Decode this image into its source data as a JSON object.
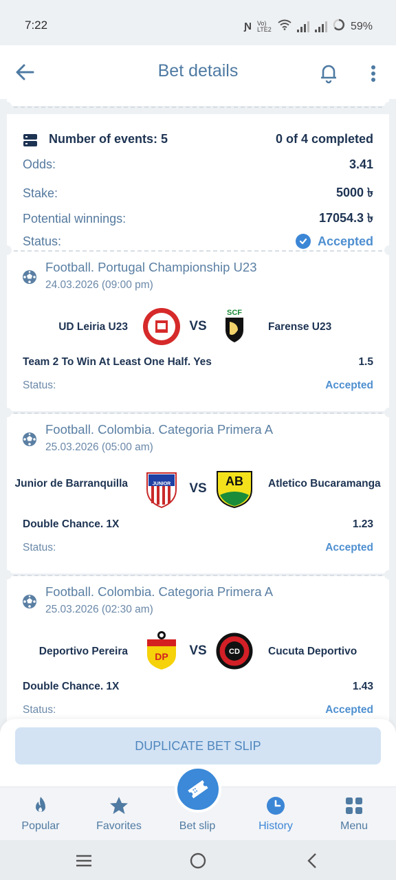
{
  "status_bar": {
    "time": "7:22",
    "battery": "59%",
    "network": "Vo) LTE2"
  },
  "header": {
    "title": "Bet details"
  },
  "summary": {
    "events_label": "Number of events: 5",
    "completed": "0 of 4 completed",
    "odds_label": "Odds:",
    "odds_value": "3.41",
    "stake_label": "Stake:",
    "stake_value": "5000 ৳",
    "winnings_label": "Potential winnings:",
    "winnings_value": "17054.3 ৳",
    "status_label": "Status:",
    "status_value": "Accepted"
  },
  "events": [
    {
      "league": "Football. Portugal Championship U23",
      "date": "24.03.2026 (09:00 pm)",
      "team1": "UD Leiria U23",
      "team2": "Farense U23",
      "vs": "VS",
      "market": "Team 2 To Win At Least One Half. Yes",
      "odds": "1.5",
      "status_label": "Status:",
      "status": "Accepted",
      "logo2_text": "SCF"
    },
    {
      "league": "Football. Colombia. Categoria Primera A",
      "date": "25.03.2026 (05:00 am)",
      "team1": "Junior de Barranquilla",
      "team2": "Atletico Bucaramanga",
      "vs": "VS",
      "market": "Double Chance. 1X",
      "odds": "1.23",
      "status_label": "Status:",
      "status": "Accepted",
      "logo1_text": "JUNIOR",
      "logo2_text": "AB"
    },
    {
      "league": "Football. Colombia. Categoria Primera A",
      "date": "25.03.2026 (02:30 am)",
      "team1": "Deportivo Pereira",
      "team2": "Cucuta Deportivo",
      "vs": "VS",
      "market": "Double Chance. 1X",
      "odds": "1.43",
      "status_label": "Status:",
      "status": "Accepted",
      "logo1_text": "DP",
      "logo2_text": "CD"
    }
  ],
  "actions": {
    "duplicate_label": "DUPLICATE BET SLIP"
  },
  "bottom_nav": [
    {
      "label": "Popular",
      "icon": "flame-icon"
    },
    {
      "label": "Favorites",
      "icon": "star-icon"
    },
    {
      "label": "Bet slip",
      "icon": "ticket-icon"
    },
    {
      "label": "History",
      "icon": "clock-icon"
    },
    {
      "label": "Menu",
      "icon": "grid-icon"
    }
  ],
  "colors": {
    "accent": "#3b89d8",
    "title": "#4e7aa2",
    "text_dark": "#1d3352",
    "background": "#eef1f4"
  }
}
